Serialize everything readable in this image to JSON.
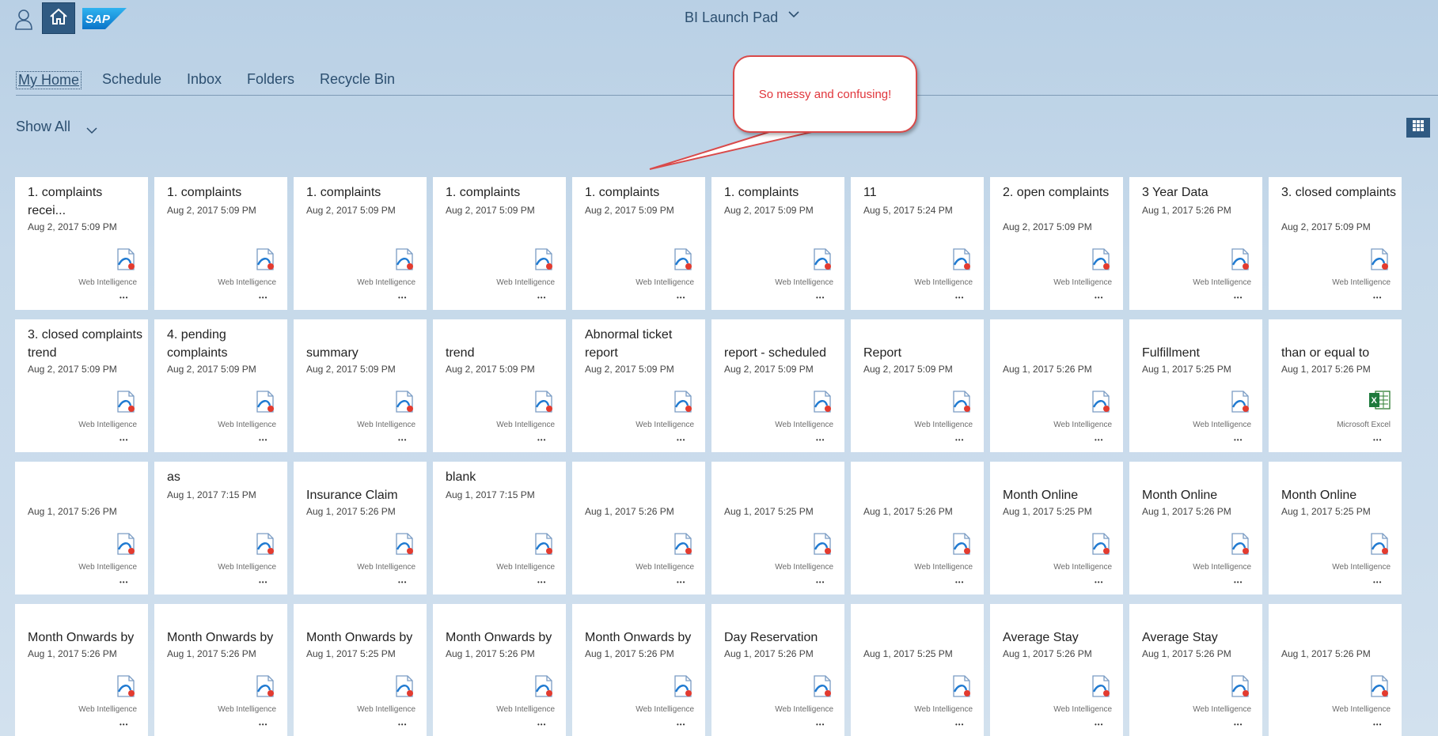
{
  "app": {
    "title": "BI Launch Pad"
  },
  "tabs": [
    {
      "label": "My Home",
      "active": true
    },
    {
      "label": "Schedule"
    },
    {
      "label": "Inbox"
    },
    {
      "label": "Folders"
    },
    {
      "label": "Recycle Bin"
    }
  ],
  "filter": {
    "label": "Show All"
  },
  "annotation": {
    "text": "So messy and confusing!"
  },
  "icons": {
    "user": "user-icon",
    "home": "home-icon",
    "grid": "grid-view-icon",
    "webi": "web-intelligence-icon",
    "excel": "excel-icon"
  },
  "colors": {
    "accent": "#2f5a82",
    "annotation": "#e0353b",
    "tile_bg": "#ffffff"
  },
  "tiles": [
    {
      "title": "1. complaints recei...",
      "date": "Aug 2, 2017 5:09 PM",
      "type": "Web Intelligence"
    },
    {
      "title": "1. complaints",
      "date": "Aug 2, 2017 5:09 PM",
      "type": "Web Intelligence"
    },
    {
      "title": "1. complaints",
      "date": "Aug 2, 2017 5:09 PM",
      "type": "Web Intelligence"
    },
    {
      "title": "1. complaints",
      "date": "Aug 2, 2017 5:09 PM",
      "type": "Web Intelligence"
    },
    {
      "title": "1. complaints",
      "date": "Aug 2, 2017 5:09 PM",
      "type": "Web Intelligence"
    },
    {
      "title": "1. complaints",
      "date": "Aug 2, 2017 5:09 PM",
      "type": "Web Intelligence"
    },
    {
      "title": "11",
      "date": "Aug 5, 2017 5:24 PM",
      "type": "Web Intelligence"
    },
    {
      "title": "2. open complaints",
      "date": "Aug 2, 2017 5:09 PM",
      "type": "Web Intelligence"
    },
    {
      "title": "3 Year Data",
      "date": "Aug 1, 2017 5:26 PM",
      "type": "Web Intelligence"
    },
    {
      "title": "3. closed complaints",
      "date": "Aug 2, 2017 5:09 PM",
      "type": "Web Intelligence"
    },
    {
      "title": "3. closed complaints trend",
      "date": "Aug 2, 2017 5:09 PM",
      "type": "Web Intelligence"
    },
    {
      "title": "4. pending complaints",
      "date": "Aug 2, 2017 5:09 PM",
      "type": "Web Intelligence"
    },
    {
      "title": "summary",
      "date": "Aug 2, 2017 5:09 PM",
      "type": "Web Intelligence"
    },
    {
      "title": "trend",
      "date": "Aug 2, 2017 5:09 PM",
      "type": "Web Intelligence"
    },
    {
      "title": "Abnormal ticket report",
      "date": "Aug 2, 2017 5:09 PM",
      "type": "Web Intelligence"
    },
    {
      "title": "report - scheduled",
      "date": "Aug 2, 2017 5:09 PM",
      "type": "Web Intelligence"
    },
    {
      "title": "Report",
      "date": "Aug 2, 2017 5:09 PM",
      "type": "Web Intelligence"
    },
    {
      "title": "",
      "date": "Aug 1, 2017 5:26 PM",
      "type": "Web Intelligence"
    },
    {
      "title": "Fulfillment",
      "date": "Aug 1, 2017 5:25 PM",
      "type": "Web Intelligence"
    },
    {
      "title": "than or equal to",
      "date": "Aug 1, 2017 5:26 PM",
      "type": "Microsoft Excel"
    },
    {
      "title": "",
      "date": "Aug 1, 2017 5:26 PM",
      "type": "Web Intelligence"
    },
    {
      "title": "as",
      "date": "Aug 1, 2017 7:15 PM",
      "type": "Web Intelligence"
    },
    {
      "title": "Insurance Claim",
      "date": "Aug 1, 2017 5:26 PM",
      "type": "Web Intelligence"
    },
    {
      "title": "blank",
      "date": "Aug 1, 2017 7:15 PM",
      "type": "Web Intelligence"
    },
    {
      "title": "",
      "date": "Aug 1, 2017 5:26 PM",
      "type": "Web Intelligence"
    },
    {
      "title": "",
      "date": "Aug 1, 2017 5:25 PM",
      "type": "Web Intelligence"
    },
    {
      "title": "",
      "date": "Aug 1, 2017 5:26 PM",
      "type": "Web Intelligence"
    },
    {
      "title": "Month Online",
      "date": "Aug 1, 2017 5:25 PM",
      "type": "Web Intelligence"
    },
    {
      "title": "Month Online",
      "date": "Aug 1, 2017 5:26 PM",
      "type": "Web Intelligence"
    },
    {
      "title": "Month Online",
      "date": "Aug 1, 2017 5:25 PM",
      "type": "Web Intelligence"
    },
    {
      "title": "Month Onwards by",
      "date": "Aug 1, 2017 5:26 PM",
      "type": "Web Intelligence"
    },
    {
      "title": "Month Onwards by",
      "date": "Aug 1, 2017 5:26 PM",
      "type": "Web Intelligence"
    },
    {
      "title": "Month Onwards by",
      "date": "Aug 1, 2017 5:25 PM",
      "type": "Web Intelligence"
    },
    {
      "title": "Month Onwards by",
      "date": "Aug 1, 2017 5:26 PM",
      "type": "Web Intelligence"
    },
    {
      "title": "Month Onwards by",
      "date": "Aug 1, 2017 5:26 PM",
      "type": "Web Intelligence"
    },
    {
      "title": "Day Reservation",
      "date": "Aug 1, 2017 5:26 PM",
      "type": "Web Intelligence"
    },
    {
      "title": "",
      "date": "Aug 1, 2017 5:25 PM",
      "type": "Web Intelligence"
    },
    {
      "title": "Average Stay",
      "date": "Aug 1, 2017 5:26 PM",
      "type": "Web Intelligence"
    },
    {
      "title": "Average Stay",
      "date": "Aug 1, 2017 5:26 PM",
      "type": "Web Intelligence"
    },
    {
      "title": "",
      "date": "Aug 1, 2017 5:26 PM",
      "type": "Web Intelligence"
    }
  ]
}
